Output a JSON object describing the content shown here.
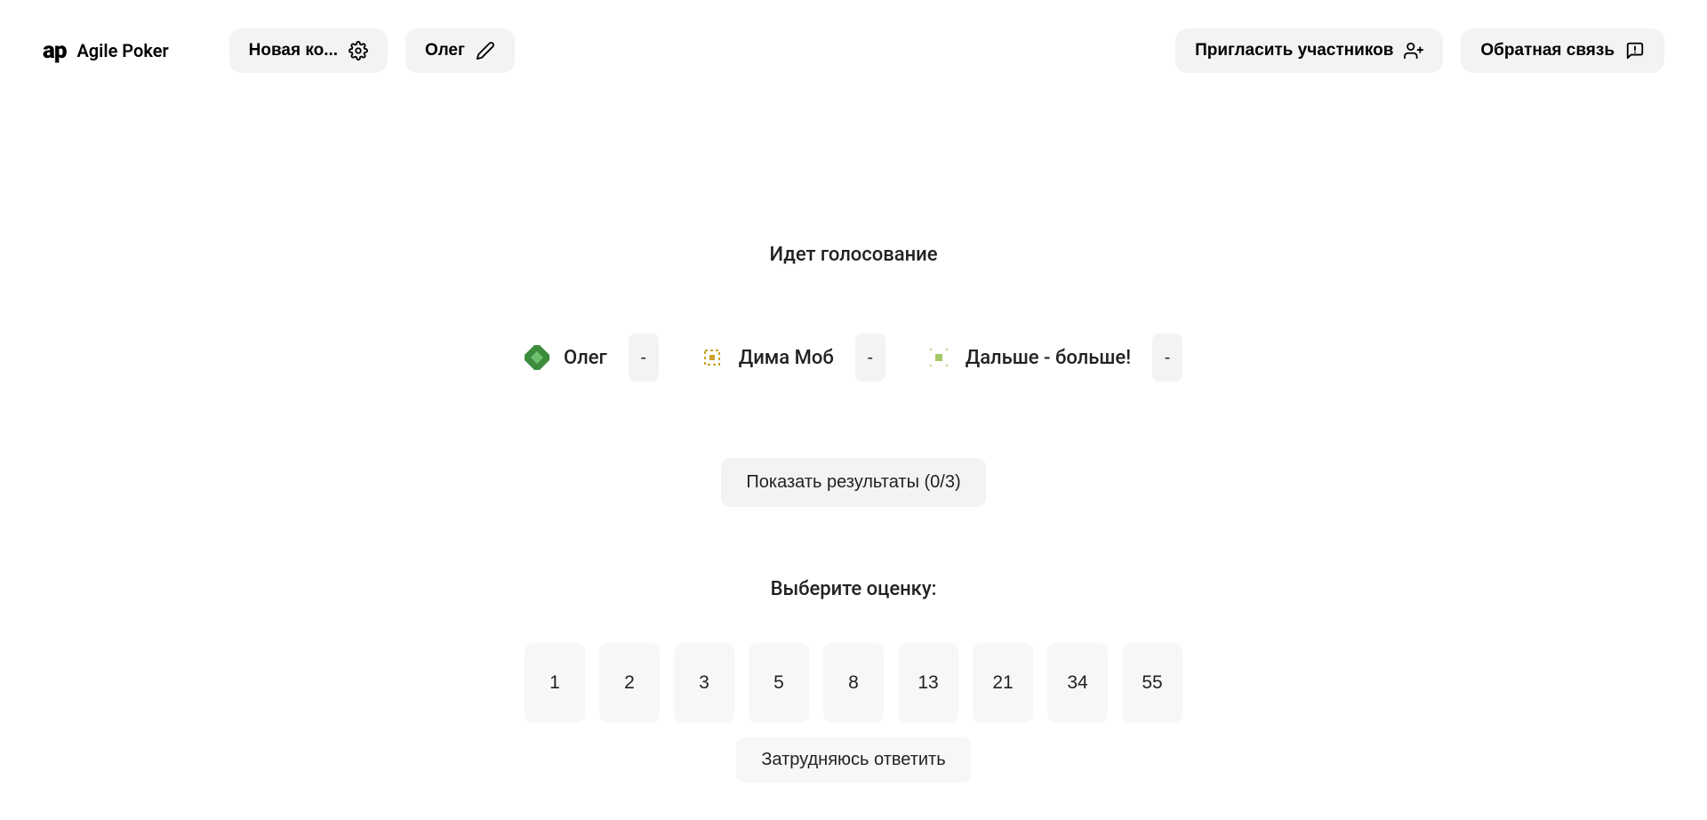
{
  "header": {
    "app_name": "Agile Poker",
    "room_label": "Новая ко...",
    "user_label": "Олег",
    "invite_label": "Пригласить участников",
    "feedback_label": "Обратная связь"
  },
  "voting": {
    "status_title": "Идет голосование",
    "show_results_label": "Показать результаты (0/3)",
    "participants": [
      {
        "name": "Олег",
        "vote": "-"
      },
      {
        "name": "Дима Моб",
        "vote": "-"
      },
      {
        "name": "Дальше - больше!",
        "vote": "-"
      }
    ]
  },
  "picker": {
    "title": "Выберите оценку:",
    "cards": [
      "1",
      "2",
      "3",
      "5",
      "8",
      "13",
      "21",
      "34",
      "55"
    ],
    "hard_label": "Затрудняюсь ответить"
  }
}
